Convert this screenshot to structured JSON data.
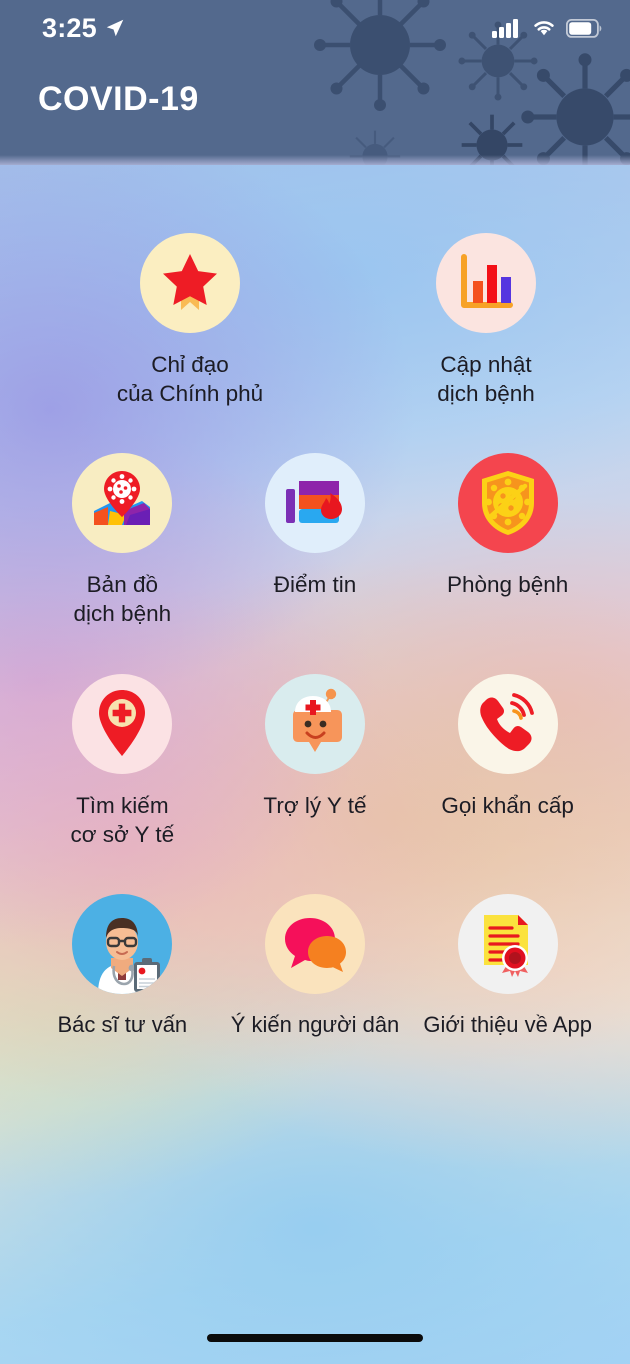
{
  "status_bar": {
    "time": "3:25",
    "location_icon": "location-arrow-icon",
    "signal_icon": "cellular-signal-icon",
    "signal_bars": 4,
    "wifi_icon": "wifi-icon",
    "battery_icon": "battery-icon",
    "battery_level": 72
  },
  "header": {
    "title": "COVID-19",
    "background_color": "#53698d",
    "title_color": "#ffffff"
  },
  "grid": {
    "rows": [
      {
        "tiles": [
          {
            "id": "chi-dao-cua-chinh-phu",
            "label": "Chỉ đạo\ncủa Chính phủ",
            "icon": "star-ribbon-icon",
            "circle_color": "#fbeec1"
          },
          {
            "id": "cap-nhat-dich-benh",
            "label": "Cập nhật\ndịch bệnh",
            "icon": "bar-chart-icon",
            "circle_color": "#fbe4e0"
          }
        ]
      },
      {
        "tiles": [
          {
            "id": "ban-do-dich-benh",
            "label": "Bản đồ\ndịch bệnh",
            "icon": "map-pin-virus-icon",
            "circle_color": "#f8edc2"
          },
          {
            "id": "diem-tin",
            "label": "Điểm tin",
            "icon": "news-flame-icon",
            "circle_color": "#e0eefb"
          },
          {
            "id": "phong-benh",
            "label": "Phòng bệnh",
            "icon": "shield-virus-block-icon",
            "circle_color": "#f4454e"
          }
        ]
      },
      {
        "tiles": [
          {
            "id": "tim-kiem-co-so-y-te",
            "label": "Tìm kiếm\ncơ sở Y tế",
            "icon": "medical-pin-icon",
            "circle_color": "#fbe2e4"
          },
          {
            "id": "tro-ly-y-te",
            "label": "Trợ lý Y tế",
            "icon": "nurse-chat-face-icon",
            "circle_color": "#d9ecee"
          },
          {
            "id": "goi-khan-cap",
            "label": "Gọi khẩn cấp",
            "icon": "phone-ring-icon",
            "circle_color": "#faf5e8"
          }
        ]
      },
      {
        "tiles": [
          {
            "id": "bac-si-tu-van",
            "label": "Bác sĩ tư vấn",
            "icon": "doctor-clipboard-icon",
            "circle_color": "#4cb0e4"
          },
          {
            "id": "y-kien-nguoi-dan",
            "label": "Ý kiến người dân",
            "icon": "speech-bubbles-icon",
            "circle_color": "#fae3bd"
          },
          {
            "id": "gioi-thieu-ve-app",
            "label": "Giới thiệu về App",
            "icon": "certificate-seal-icon",
            "circle_color": "#f1f1f1"
          }
        ]
      }
    ]
  },
  "home_indicator": {
    "label": "home-indicator",
    "color": "#0b0b0b"
  },
  "colors": {
    "accent_red": "#ee1c25",
    "accent_orange": "#f7941d",
    "accent_blue": "#4cb0e4",
    "text_primary": "#1c1c24"
  }
}
